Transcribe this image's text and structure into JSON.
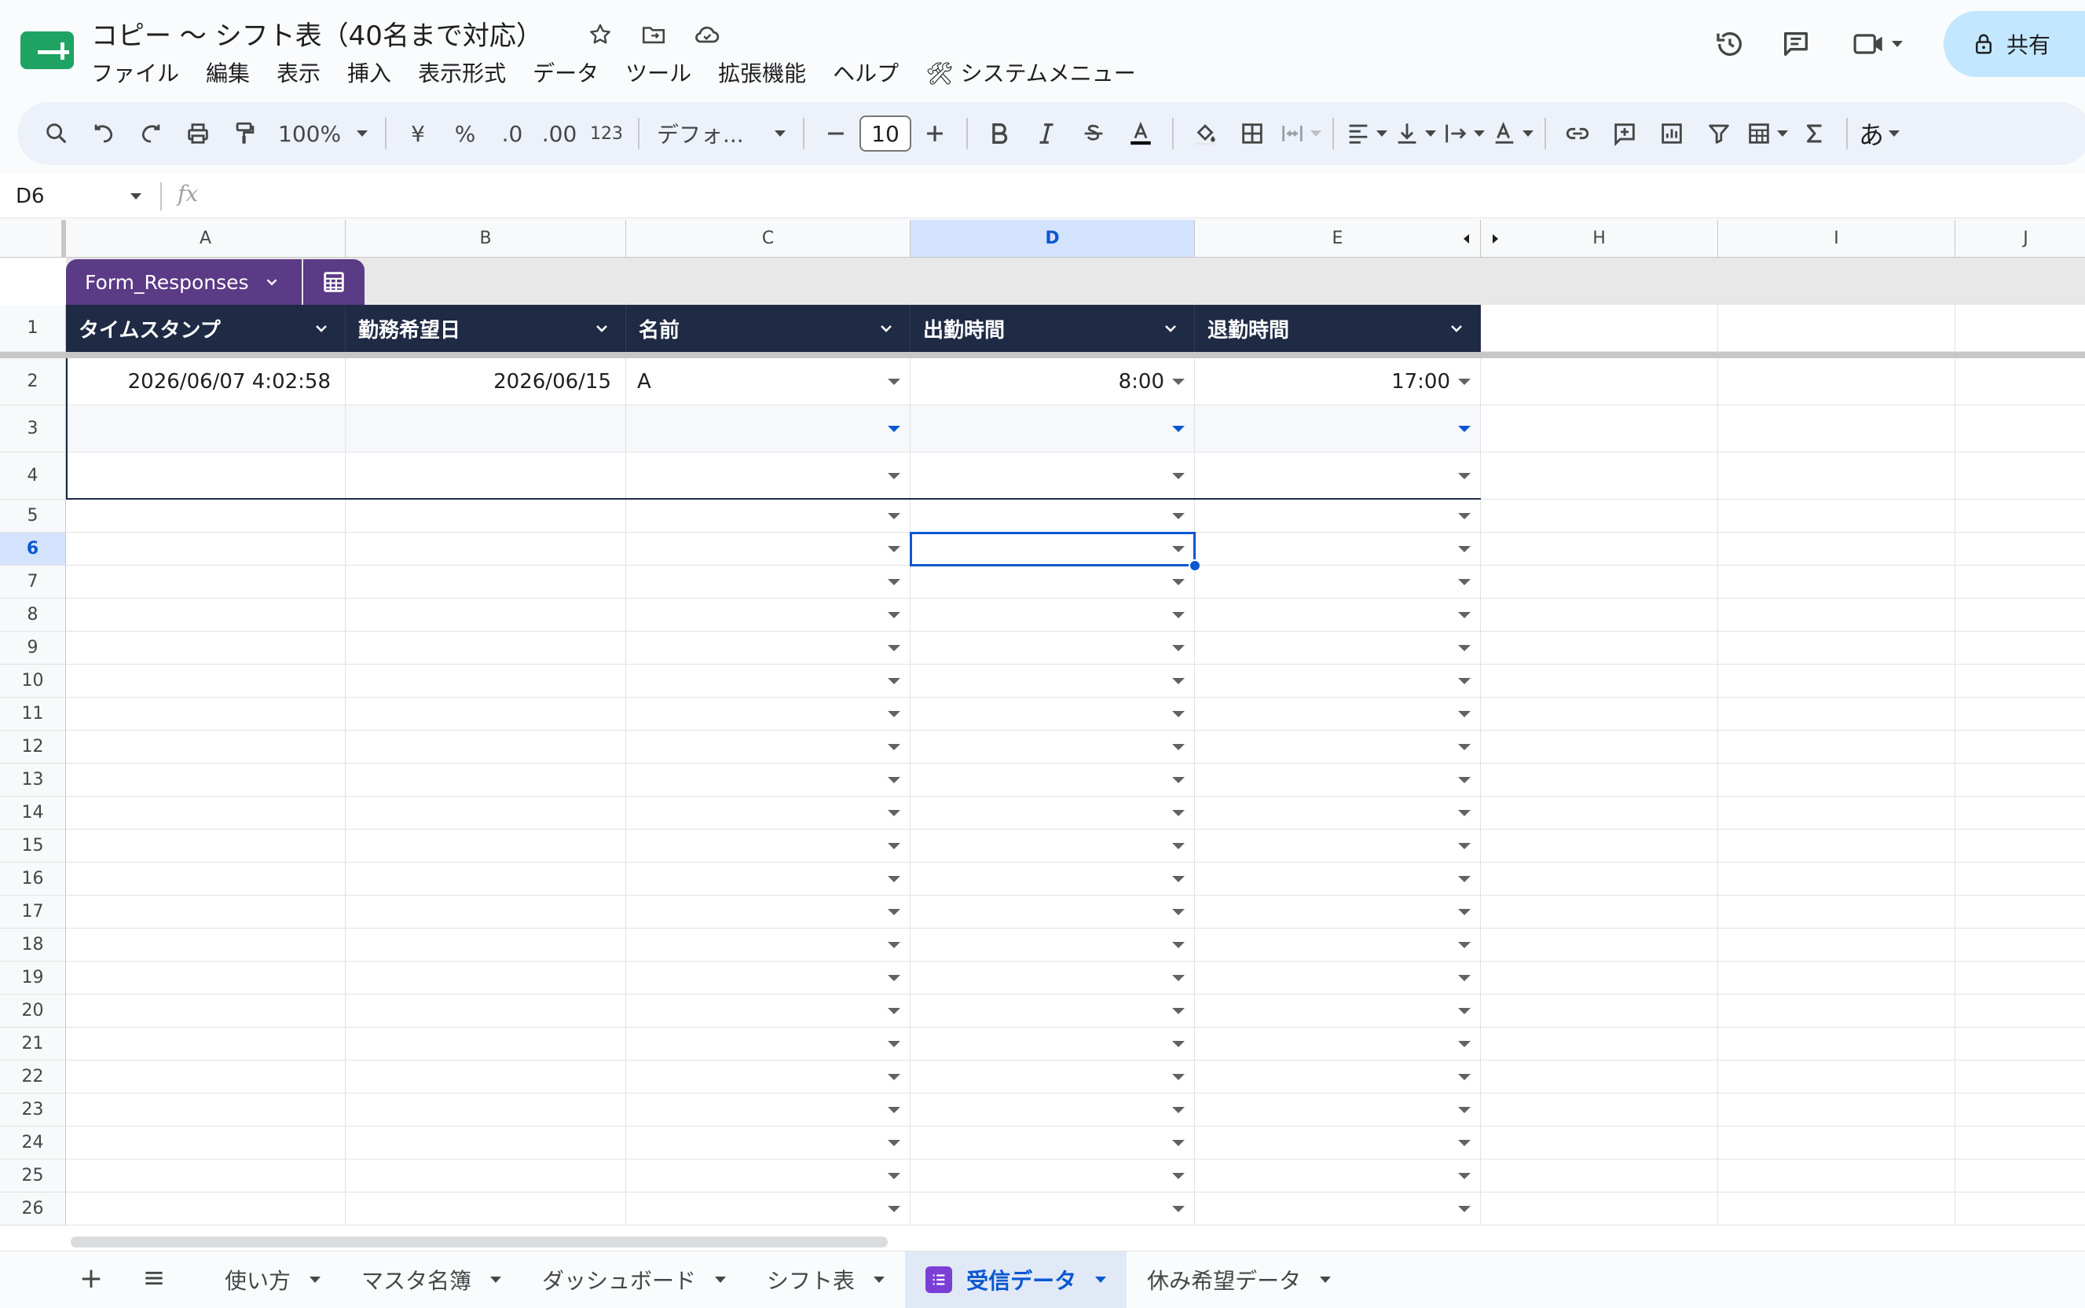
{
  "doc": {
    "title": "コピー 〜 シフト表（40名まで対応）",
    "menus": [
      "ファイル",
      "編集",
      "表示",
      "挿入",
      "表示形式",
      "データ",
      "ツール",
      "拡張機能",
      "ヘルプ",
      "🛠 システムメニュー"
    ],
    "share_label": "共有"
  },
  "toolbar": {
    "zoom": "100%",
    "currency": "¥",
    "percent": "%",
    "dec_decrease": ".0",
    "dec_increase": ".00",
    "number_format": "123",
    "font": "デフォ...",
    "font_size": "10",
    "input_method": "あ"
  },
  "formula_bar": {
    "cell_ref": "D6",
    "fx": "fx",
    "value": ""
  },
  "columns": [
    "A",
    "B",
    "C",
    "D",
    "E",
    "H",
    "I",
    "J"
  ],
  "selected_cell": "D6",
  "table": {
    "name": "Form_Responses",
    "headers": [
      "タイムスタンプ",
      "勤務希望日",
      "名前",
      "出勤時間",
      "退勤時間"
    ]
  },
  "rows": [
    {
      "num": "1"
    },
    {
      "num": "2",
      "a": "2026/06/07 4:02:58",
      "b": "2026/06/15",
      "c": "A",
      "d": "8:00",
      "e": "17:00"
    },
    {
      "num": "3"
    },
    {
      "num": "4"
    },
    {
      "num": "5"
    },
    {
      "num": "6"
    },
    {
      "num": "7"
    },
    {
      "num": "8"
    },
    {
      "num": "9"
    },
    {
      "num": "10"
    },
    {
      "num": "11"
    },
    {
      "num": "12"
    },
    {
      "num": "13"
    },
    {
      "num": "14"
    },
    {
      "num": "15"
    },
    {
      "num": "16"
    },
    {
      "num": "17"
    },
    {
      "num": "18"
    },
    {
      "num": "19"
    },
    {
      "num": "20"
    },
    {
      "num": "21"
    },
    {
      "num": "22"
    },
    {
      "num": "23"
    },
    {
      "num": "24"
    },
    {
      "num": "25"
    },
    {
      "num": "26"
    }
  ],
  "sheets": {
    "tabs": [
      "使い方",
      "マスタ名簿",
      "ダッシュボード",
      "シフト表",
      "受信データ",
      "休み希望データ"
    ],
    "active": "受信データ"
  },
  "colors": {
    "accent": "#0b57d0",
    "table_header": "#1f2a44",
    "table_chip": "#5b3a86",
    "share_bg": "#c2e7ff"
  }
}
